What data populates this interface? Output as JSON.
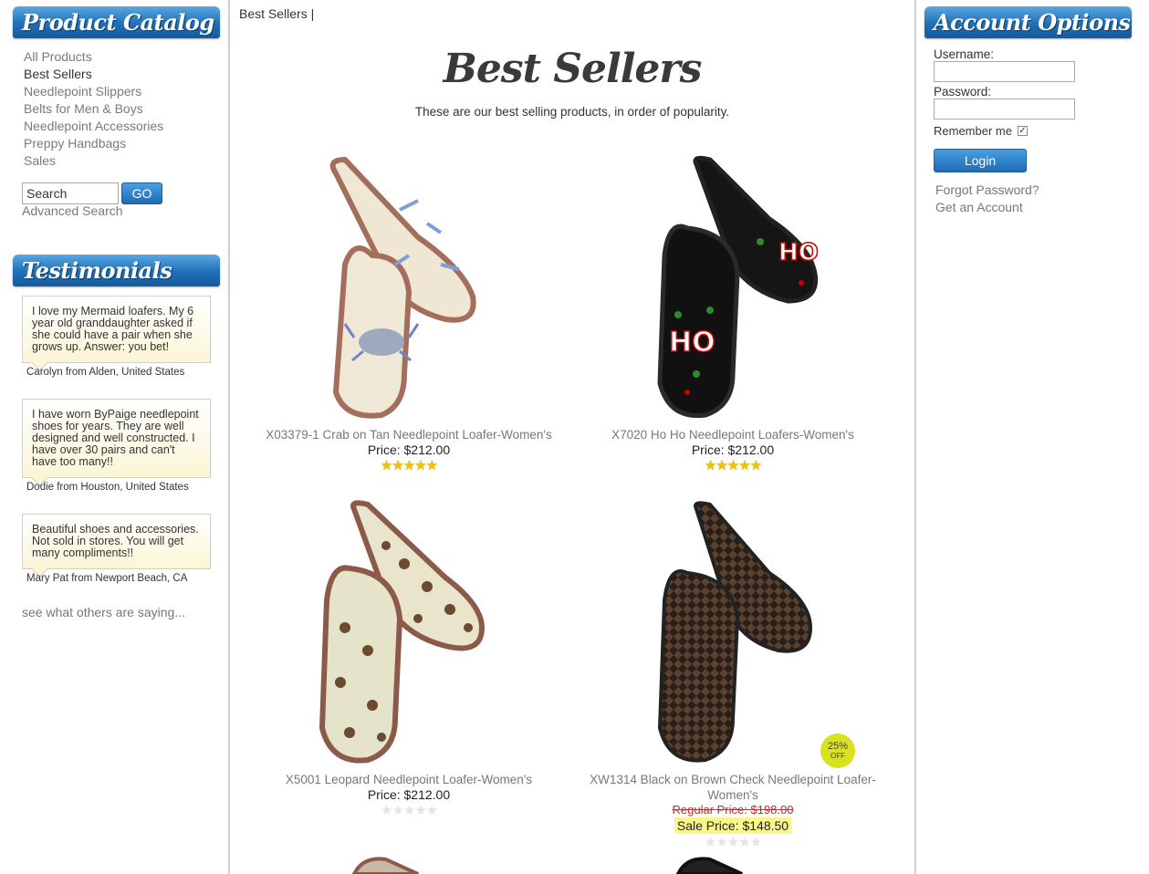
{
  "sidebar": {
    "catalog_title": "Product Catalog",
    "catalog_items": [
      {
        "label": "All Products"
      },
      {
        "label": "Best Sellers"
      },
      {
        "label": "Needlepoint Slippers"
      },
      {
        "label": "Belts for Men & Boys"
      },
      {
        "label": "Needlepoint Accessories"
      },
      {
        "label": "Preppy Handbags"
      },
      {
        "label": "Sales"
      }
    ],
    "search_value": "Search",
    "go_label": "GO",
    "advanced_search_label": "Advanced Search",
    "testimonials_title": "Testimonials",
    "testimonials": [
      {
        "text": "I love my Mermaid loafers. My 6 year old granddaughter asked if she could have a pair when she grows up. Answer: you bet!",
        "author": "Carolyn from Alden, United States"
      },
      {
        "text": "I have worn ByPaige needlepoint shoes for years. They are well designed and well constructed. I have over 30 pairs and can't have too many!!",
        "author": "Dodie from Houston, United States"
      },
      {
        "text": "Beautiful shoes and accessories. Not sold in stores. You will get many compliments!!",
        "author": "Mary Pat from Newport Beach, CA"
      }
    ],
    "see_more_label": "see what others are saying..."
  },
  "main": {
    "breadcrumb": "Best Sellers |",
    "title": "Best Sellers",
    "subtitle": "These are our best selling products, in order of popularity.",
    "products": [
      {
        "name": "X03379-1 Crab on Tan Needlepoint Loafer-Women's",
        "price": "Price: $212.00",
        "rating": 5
      },
      {
        "name": "X7020 Ho Ho Needlepoint Loafers-Women's",
        "price": "Price: $212.00",
        "rating": 5
      },
      {
        "name": "X5001 Leopard Needlepoint Loafer-Women's",
        "price": "Price: $212.00",
        "rating": 0
      },
      {
        "name": "XW1314 Black on Brown Check Needlepoint Loafer- Women's",
        "regular_price": "Regular Price: $198.00",
        "sale_price": "Sale Price: $148.50",
        "badge_pct": "25%",
        "badge_off": "OFF",
        "rating": 0
      }
    ]
  },
  "account": {
    "title": "Account Options",
    "username_label": "Username:",
    "password_label": "Password:",
    "remember_label": "Remember me",
    "remember_checked": true,
    "login_label": "Login",
    "forgot_label": "Forgot Password?",
    "get_account_label": "Get an Account"
  },
  "colors": {
    "header_blue": "#1f6fb8",
    "sale_highlight": "#fbf68a",
    "badge": "#d9e21f",
    "star": "#f2c200"
  }
}
